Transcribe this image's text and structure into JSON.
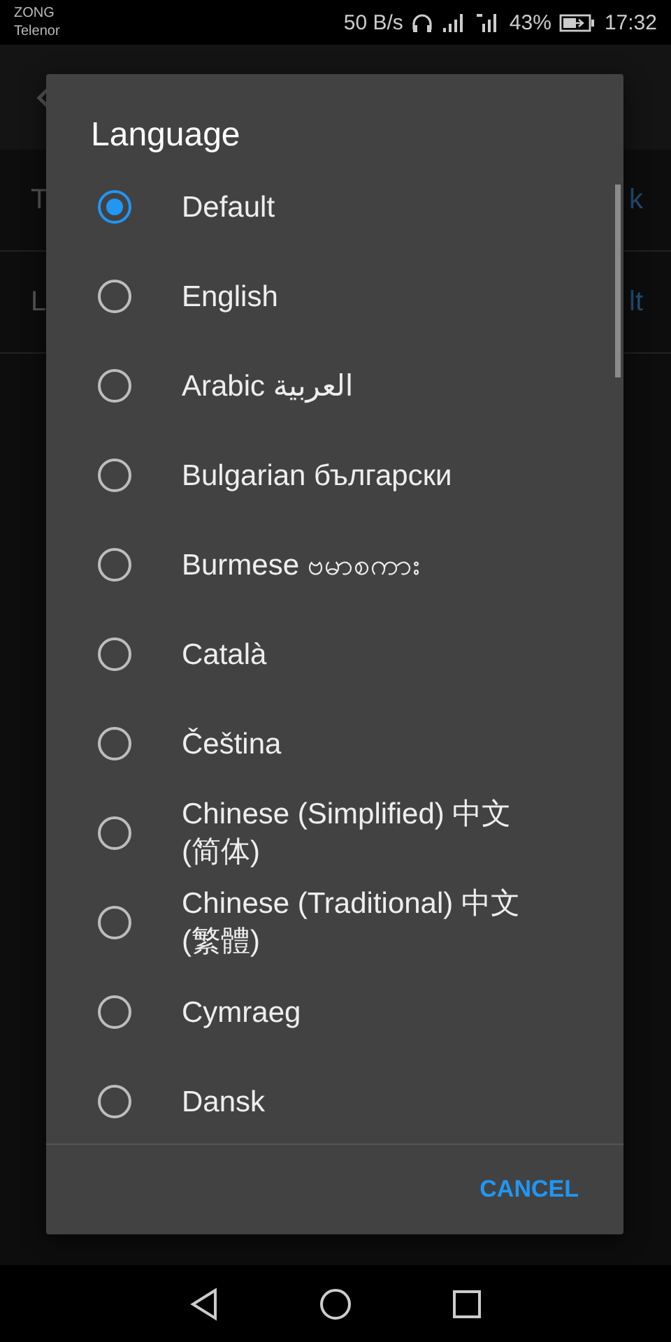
{
  "status_bar": {
    "carriers": [
      "ZONG",
      "Telenor"
    ],
    "speed": "50 B/s",
    "battery": "43%",
    "time": "17:32"
  },
  "background": {
    "rows": [
      {
        "label": "T",
        "value": "k"
      },
      {
        "label": "L",
        "value": "lt"
      }
    ]
  },
  "dialog": {
    "title": "Language",
    "options": [
      {
        "label": "Default",
        "selected": true
      },
      {
        "label": "English",
        "selected": false
      },
      {
        "label": "Arabic العربية",
        "selected": false
      },
      {
        "label": "Bulgarian български",
        "selected": false
      },
      {
        "label": "Burmese ဗမာစကား",
        "selected": false
      },
      {
        "label": "Català",
        "selected": false
      },
      {
        "label": "Čeština",
        "selected": false
      },
      {
        "label": "Chinese (Simplified) 中文 (简体)",
        "selected": false
      },
      {
        "label": "Chinese (Traditional) 中文 (繁體)",
        "selected": false
      },
      {
        "label": "Cymraeg",
        "selected": false
      },
      {
        "label": "Dansk",
        "selected": false
      }
    ],
    "cancel": "CANCEL"
  }
}
